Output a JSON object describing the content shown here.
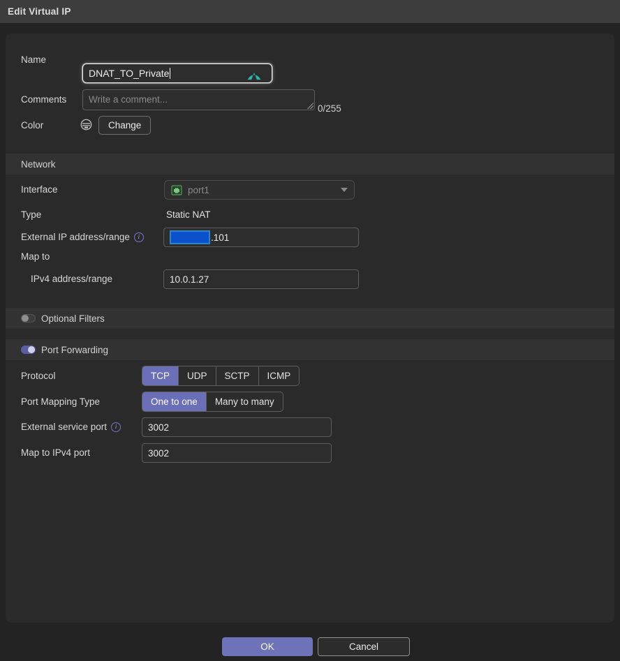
{
  "titlebar": {
    "title": "Edit Virtual IP"
  },
  "form": {
    "name": {
      "label": "Name",
      "value": "DNAT_TO_Private"
    },
    "comments": {
      "label": "Comments",
      "placeholder": "Write a comment...",
      "counter": "0/255"
    },
    "color": {
      "label": "Color",
      "button": "Change"
    },
    "network": {
      "header": "Network",
      "interface": {
        "label": "Interface",
        "value": "port1"
      },
      "type": {
        "label": "Type",
        "value": "Static NAT"
      },
      "external_ip": {
        "label": "External IP address/range",
        "info": "i",
        "value_suffix": ".101"
      },
      "map_to": {
        "label": "Map to"
      },
      "ipv4": {
        "label": "IPv4 address/range",
        "value": "10.0.1.27"
      }
    },
    "optional_filters": {
      "label": "Optional Filters",
      "enabled": false
    },
    "port_forwarding": {
      "label": "Port Forwarding",
      "enabled": true,
      "protocol": {
        "label": "Protocol",
        "options": [
          "TCP",
          "UDP",
          "SCTP",
          "ICMP"
        ],
        "selected": "TCP"
      },
      "port_mapping_type": {
        "label": "Port Mapping Type",
        "options": [
          "One to one",
          "Many to many"
        ],
        "selected": "One to one"
      },
      "external_service_port": {
        "label": "External service port",
        "info": "i",
        "value": "3002"
      },
      "map_to_port": {
        "label": "Map to IPv4 port",
        "value": "3002"
      }
    }
  },
  "footer": {
    "ok": "OK",
    "cancel": "Cancel"
  },
  "colors": {
    "accent_purple": "#6b6fb8",
    "toggle_on": "#5b5e9e",
    "redact_fill": "#0b51cc",
    "redact_border": "#2c85c7",
    "password_manager_teal": "#2bb3ad",
    "port_icon_green": "#4f9e55",
    "titlebar_bg": "#3d3d3d",
    "panel_bg": "#2a2a2a"
  }
}
